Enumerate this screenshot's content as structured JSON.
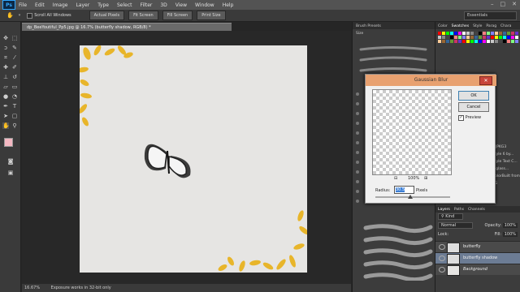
{
  "app": {
    "logo": "Ps"
  },
  "menu": [
    "File",
    "Edit",
    "Image",
    "Layer",
    "Type",
    "Select",
    "Filter",
    "3D",
    "View",
    "Window",
    "Help"
  ],
  "window_controls": [
    "–",
    "□",
    "✕"
  ],
  "options": {
    "scroll_all_label": "Scroll All Windows",
    "actual_pixels": "Actual Pixels",
    "fit_screen": "Fit Screen",
    "fill_screen": "Fill Screen",
    "print_size": "Print Size",
    "workspace": "Essentials"
  },
  "document": {
    "tab_title": "dp_BeeYoutiful_Pp5.jpg @ 16.7% (butterfly shadow, RGB/8) *"
  },
  "status": {
    "zoom": "16.67%",
    "message": "Exposure works in 32-bit only"
  },
  "brush_panel": {
    "tab": "Brush Presets",
    "size_label": "Size"
  },
  "color_panel": {
    "tabs": [
      "Color",
      "Swatches",
      "Style",
      "Parag",
      "Chara"
    ]
  },
  "history_snippets": [
    "MJPKG3",
    "Style 6 by...",
    "Style Text C...",
    "1 glass...",
    "ColorBuilt from 8G"
  ],
  "layers_panel": {
    "tabs": [
      "Layers",
      "Paths",
      "Channels"
    ],
    "kind_label": "Kind",
    "blend_mode": "Normal",
    "opacity_label": "Opacity:",
    "opacity_value": "100%",
    "lock_label": "Lock:",
    "fill_label": "Fill:",
    "fill_value": "100%",
    "layers": [
      {
        "name": "butterfly",
        "selected": false
      },
      {
        "name": "butterfly shadow",
        "selected": true
      },
      {
        "name": "Background",
        "selected": false
      }
    ]
  },
  "dialog": {
    "title": "Gaussian Blur",
    "ok": "OK",
    "cancel": "Cancel",
    "preview_label": "Preview",
    "preview_checked": true,
    "zoom": "100%",
    "radius_label": "Radius:",
    "radius_value": "30.5",
    "unit": "Pixels"
  },
  "colors": {
    "accent": "#e8a170",
    "foreground": "#f4b8c2",
    "flower": "#e8b52a"
  }
}
